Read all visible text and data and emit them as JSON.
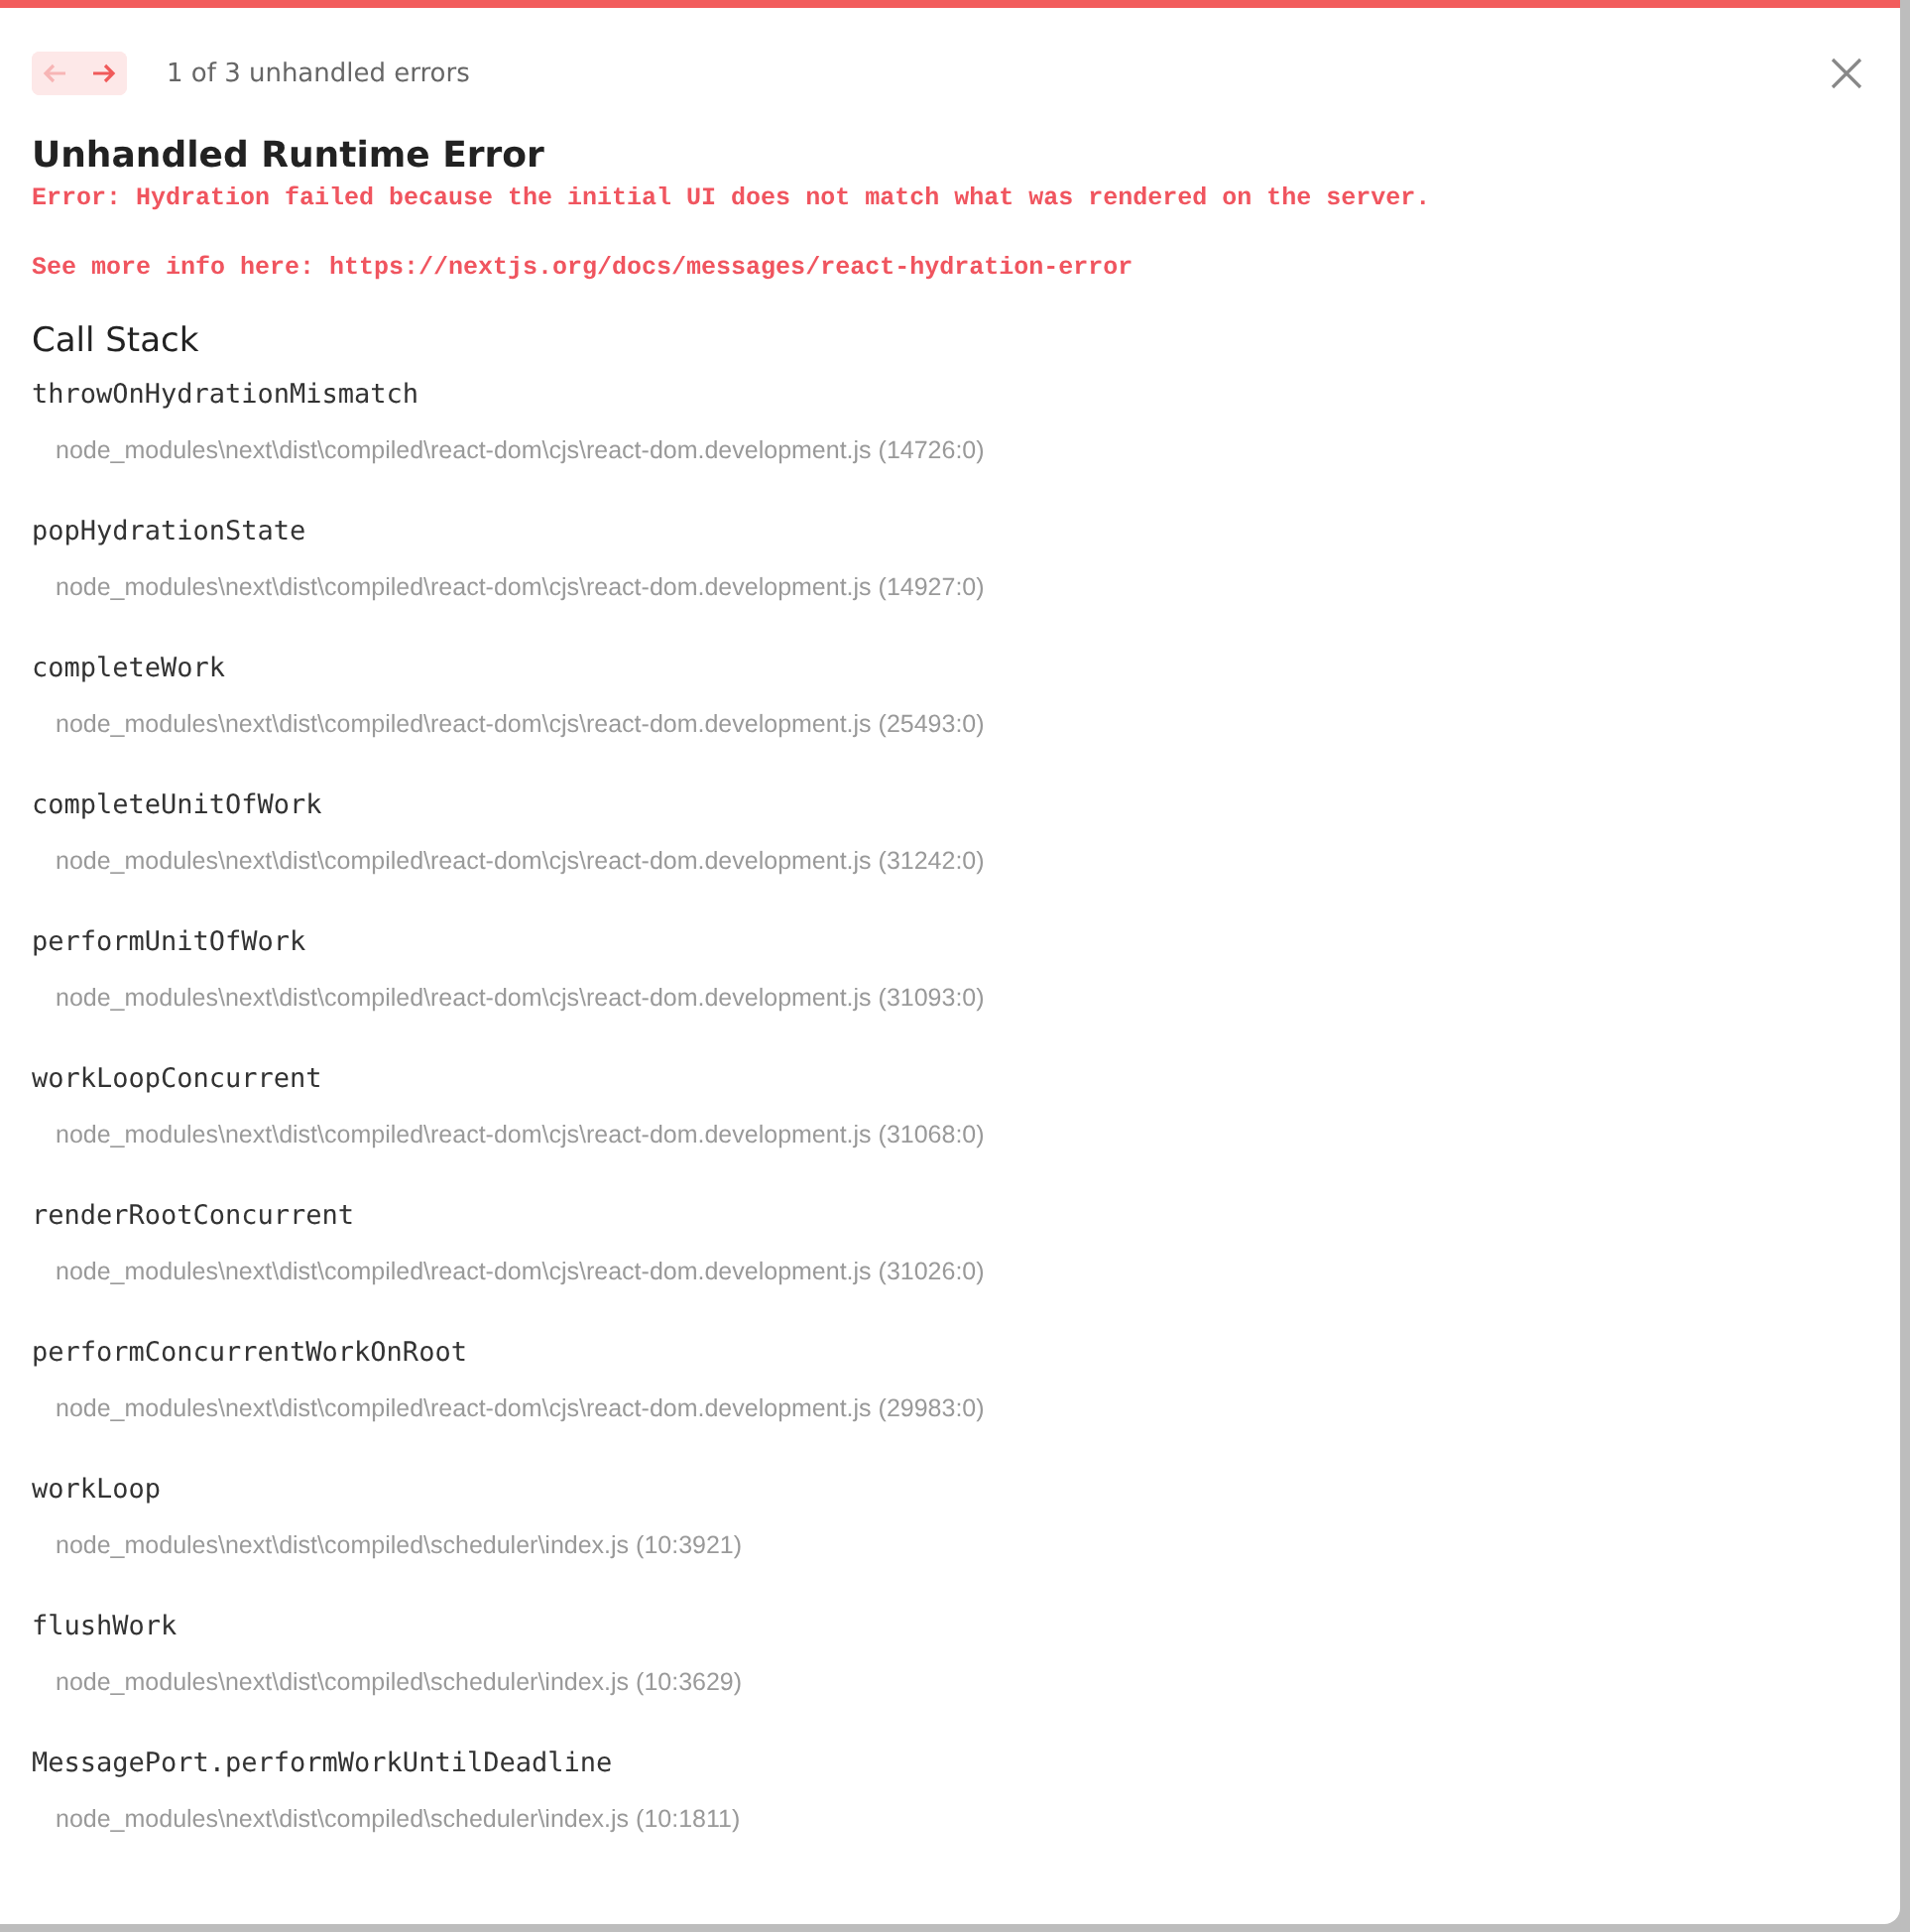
{
  "nav": {
    "prev": {
      "disabled": true
    },
    "next": {
      "disabled": false
    },
    "counter": "1 of 3 unhandled errors"
  },
  "title": "Unhandled Runtime Error",
  "message": "Error: Hydration failed because the initial UI does not match what was rendered on the server.",
  "info": "See more info here: https://nextjs.org/docs/messages/react-hydration-error",
  "call_stack": {
    "heading": "Call Stack",
    "frames": [
      {
        "name": "throwOnHydrationMismatch",
        "location": "node_modules\\next\\dist\\compiled\\react-dom\\cjs\\react-dom.development.js (14726:0)"
      },
      {
        "name": "popHydrationState",
        "location": "node_modules\\next\\dist\\compiled\\react-dom\\cjs\\react-dom.development.js (14927:0)"
      },
      {
        "name": "completeWork",
        "location": "node_modules\\next\\dist\\compiled\\react-dom\\cjs\\react-dom.development.js (25493:0)"
      },
      {
        "name": "completeUnitOfWork",
        "location": "node_modules\\next\\dist\\compiled\\react-dom\\cjs\\react-dom.development.js (31242:0)"
      },
      {
        "name": "performUnitOfWork",
        "location": "node_modules\\next\\dist\\compiled\\react-dom\\cjs\\react-dom.development.js (31093:0)"
      },
      {
        "name": "workLoopConcurrent",
        "location": "node_modules\\next\\dist\\compiled\\react-dom\\cjs\\react-dom.development.js (31068:0)"
      },
      {
        "name": "renderRootConcurrent",
        "location": "node_modules\\next\\dist\\compiled\\react-dom\\cjs\\react-dom.development.js (31026:0)"
      },
      {
        "name": "performConcurrentWorkOnRoot",
        "location": "node_modules\\next\\dist\\compiled\\react-dom\\cjs\\react-dom.development.js (29983:0)"
      },
      {
        "name": "workLoop",
        "location": "node_modules\\next\\dist\\compiled\\scheduler\\index.js (10:3921)"
      },
      {
        "name": "flushWork",
        "location": "node_modules\\next\\dist\\compiled\\scheduler\\index.js (10:3629)"
      },
      {
        "name": "MessagePort.performWorkUntilDeadline",
        "location": "node_modules\\next\\dist\\compiled\\scheduler\\index.js (10:1811)"
      }
    ]
  }
}
